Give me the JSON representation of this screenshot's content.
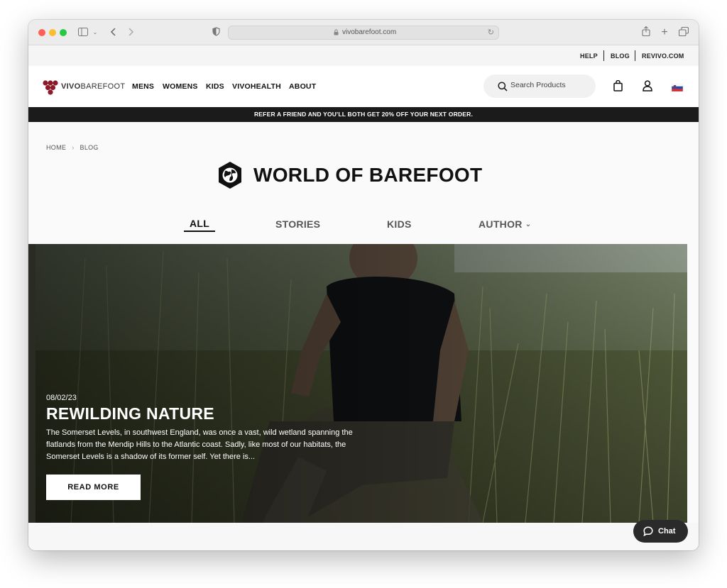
{
  "browser": {
    "url": "vivobarefoot.com"
  },
  "utility_links": [
    "HELP",
    "BLOG",
    "REVIVO.COM"
  ],
  "header": {
    "logo_bold": "VIVO",
    "logo_light": "BAREFOOT",
    "nav": [
      "MENS",
      "WOMENS",
      "KIDS",
      "VIVOHEALTH",
      "ABOUT"
    ],
    "search_placeholder": "Search Products"
  },
  "promo": "REFER A FRIEND AND YOU'LL BOTH GET 20% OFF YOUR NEXT ORDER.",
  "breadcrumb": [
    "HOME",
    "BLOG"
  ],
  "blog_title": "WORLD OF BAREFOOT",
  "tabs": {
    "all": "ALL",
    "stories": "STORIES",
    "kids": "KIDS",
    "author": "AUTHOR"
  },
  "hero": {
    "date": "08/02/23",
    "title": "REWILDING NATURE",
    "excerpt": "The Somerset Levels, in southwest England, was once a vast, wild wetland spanning the flatlands from the Mendip Hills to the Atlantic coast. Sadly, like most of our habitats, the Somerset Levels is a shadow of its former self. Yet there is...",
    "button": "READ MORE"
  },
  "chat": {
    "label": "Chat"
  },
  "colors": {
    "brand_red": "#8b1a2b",
    "promo_bg": "#1b1b1b",
    "chat_bg": "#2a2a2a"
  }
}
